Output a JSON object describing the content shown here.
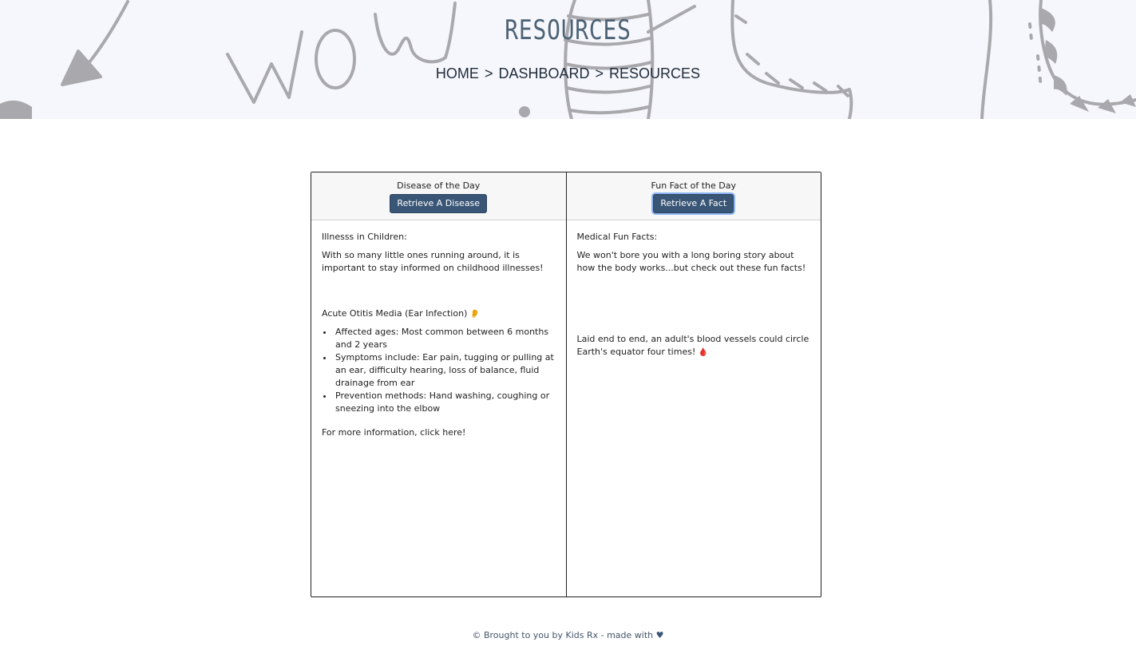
{
  "header": {
    "title": "RESOURCES",
    "breadcrumb": {
      "home": "HOME",
      "dashboard": "DASHBOARD",
      "current": "RESOURCES",
      "separator": ">"
    }
  },
  "disease_card": {
    "title": "Disease of the Day",
    "button_label": "Retrieve A Disease",
    "heading": "Illnesss in Children:",
    "intro": "With so many little ones running around, it is important to stay informed on childhood illnesses!",
    "disease_name": "Acute Otitis Media (Ear Infection)",
    "disease_emoji": "👂",
    "bullets": [
      "Affected ages: Most common between 6 months and 2 years",
      "Symptoms include: Ear pain, tugging or pulling at an ear, difficulty hearing, loss of balance, fluid drainage from ear",
      "Prevention methods: Hand washing, coughing or sneezing into the elbow"
    ],
    "more_info": "For more information, click here!"
  },
  "fact_card": {
    "title": "Fun Fact of the Day",
    "button_label": "Retrieve A Fact",
    "heading": "Medical Fun Facts:",
    "intro": "We won't bore you with a long boring story about how the body works...but check out these fun facts!",
    "fact": "Laid end to end, an adult's blood vessels could circle Earth's equator four times!",
    "fact_emoji": "🩸"
  },
  "footer": {
    "text": "© Brought to you by Kids Rx - made with",
    "heart": "♥"
  },
  "colors": {
    "hero_bg": "#f6f7fd",
    "button_bg": "#3a5676",
    "title_color": "#4d6274"
  }
}
